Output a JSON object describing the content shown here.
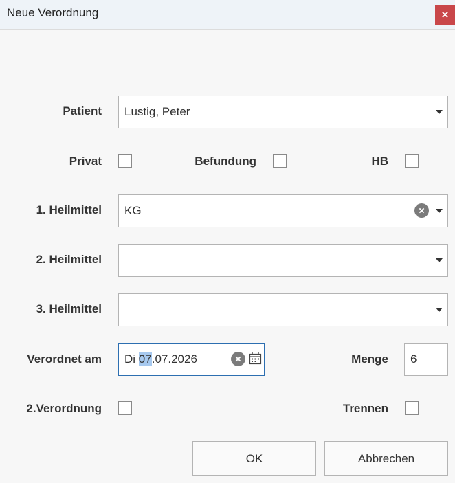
{
  "window": {
    "title": "Neue Verordnung",
    "close_glyph": "×"
  },
  "form": {
    "patient": {
      "label": "Patient",
      "value": "Lustig, Peter"
    },
    "privat": {
      "label": "Privat",
      "checked": false
    },
    "befundung": {
      "label": "Befundung",
      "checked": false
    },
    "hb": {
      "label": "HB",
      "checked": false
    },
    "heilmittel_1": {
      "label": "1. Heilmittel",
      "value": "KG"
    },
    "heilmittel_2": {
      "label": "2. Heilmittel",
      "value": ""
    },
    "heilmittel_3": {
      "label": "3. Heilmittel",
      "value": ""
    },
    "verordnet_am": {
      "label": "Verordnet am",
      "weekday": "Di",
      "day": "07",
      "rest": ".07.2026"
    },
    "menge": {
      "label": "Menge",
      "value": "6"
    },
    "zweite_verordnung": {
      "label": "2.Verordnung",
      "checked": false
    },
    "trennen": {
      "label": "Trennen",
      "checked": false
    }
  },
  "buttons": {
    "ok": "OK",
    "cancel": "Abbrechen"
  },
  "colors": {
    "accent": "#2d6fb1",
    "close": "#c9474a",
    "selection": "#a7c9ef"
  }
}
